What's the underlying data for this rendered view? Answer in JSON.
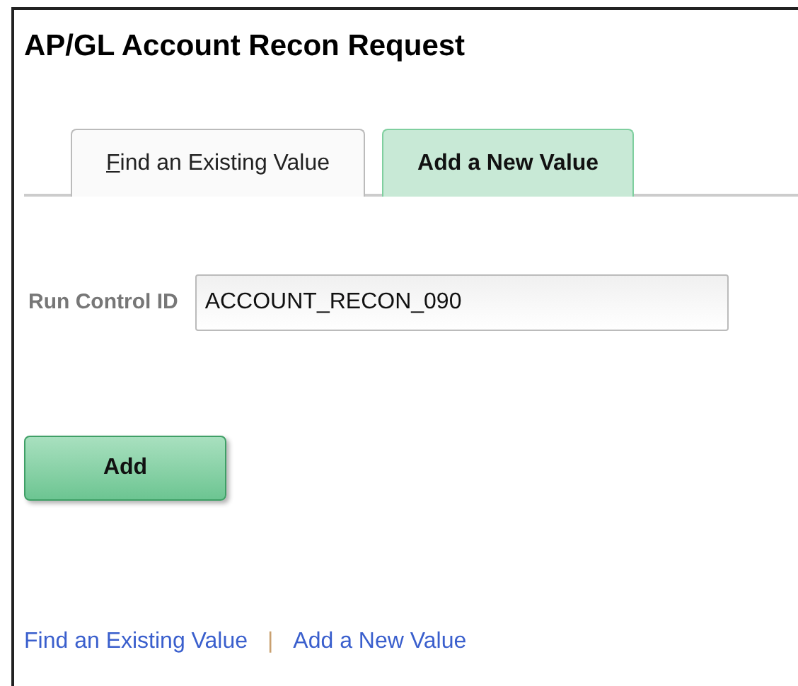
{
  "page": {
    "title": "AP/GL Account Recon Request"
  },
  "tabs": [
    {
      "label": "Find an Existing Value",
      "selected": false
    },
    {
      "label": "Add a New Value",
      "selected": true
    }
  ],
  "form": {
    "label": "Run Control ID",
    "value": "ACCOUNT_RECON_090"
  },
  "buttons": [
    "Add"
  ],
  "footer_links": [
    "Find an Existing Value",
    "Add a New Value"
  ],
  "footer_separator": "|"
}
